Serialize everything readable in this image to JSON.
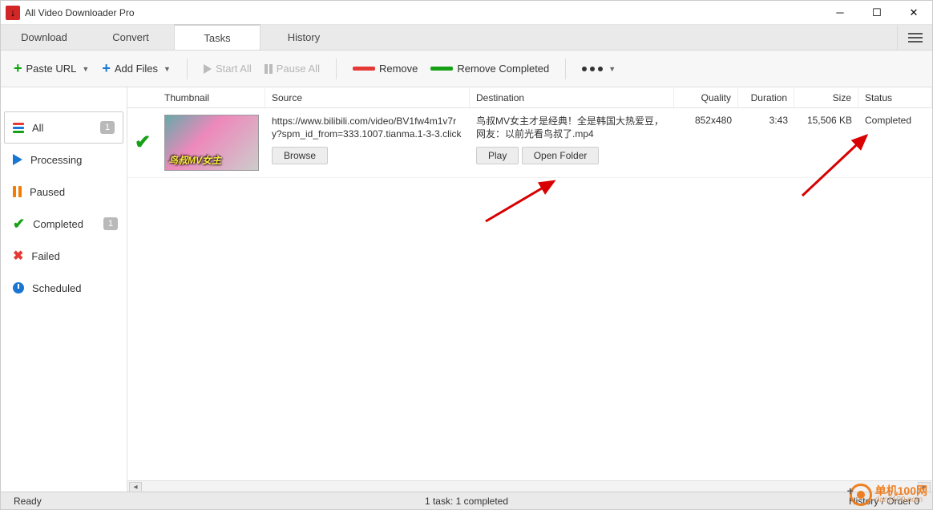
{
  "window": {
    "title": "All Video Downloader Pro"
  },
  "tabs": {
    "download": "Download",
    "convert": "Convert",
    "tasks": "Tasks",
    "history": "History"
  },
  "toolbar": {
    "paste_url": "Paste URL",
    "add_files": "Add Files",
    "start_all": "Start All",
    "pause_all": "Pause All",
    "remove": "Remove",
    "remove_completed": "Remove Completed"
  },
  "sidebar": {
    "all": {
      "label": "All",
      "count": "1"
    },
    "processing": {
      "label": "Processing"
    },
    "paused": {
      "label": "Paused"
    },
    "completed": {
      "label": "Completed",
      "count": "1"
    },
    "failed": {
      "label": "Failed"
    },
    "scheduled": {
      "label": "Scheduled"
    }
  },
  "columns": {
    "thumbnail": "Thumbnail",
    "source": "Source",
    "destination": "Destination",
    "quality": "Quality",
    "duration": "Duration",
    "size": "Size",
    "status": "Status"
  },
  "task": {
    "thumb_caption": "鸟叔MV女主",
    "source": "https://www.bilibili.com/video/BV1fw4m1v7ry?spm_id_from=333.1007.tianma.1-3-3.click",
    "destination": "鸟叔MV女主才是经典！全是韩国大热爱豆，网友：以前光看鸟叔了.mp4",
    "quality": "852x480",
    "duration": "3:43",
    "size": "15,506 KB",
    "status": "Completed",
    "browse": "Browse",
    "play": "Play",
    "open_folder": "Open Folder"
  },
  "statusbar": {
    "left": "Ready",
    "center": "1 task: 1 completed",
    "right": "History / Order 0"
  },
  "watermark": {
    "name": "单机100网",
    "domain": "danji100.com"
  }
}
